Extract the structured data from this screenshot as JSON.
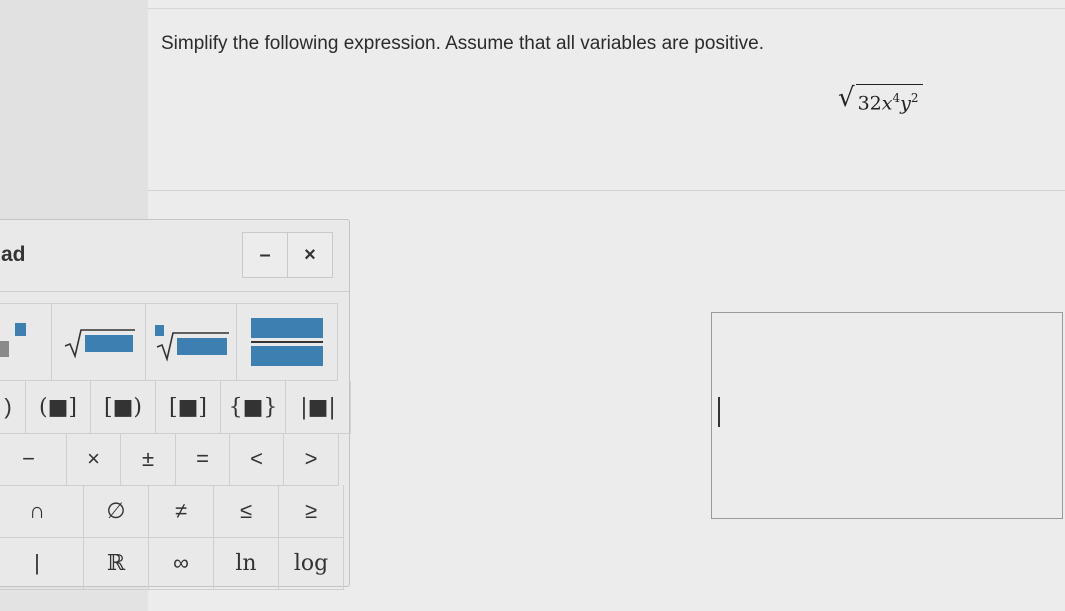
{
  "question": {
    "text": "Simplify the following expression. Assume that all variables are positive.",
    "expression": {
      "coefficient": "32",
      "var1": "x",
      "exp1": "4",
      "var2": "y",
      "exp2": "2"
    }
  },
  "keypad": {
    "title": "ad",
    "minimize_label": "–",
    "close_label": "×",
    "bracket_keys": [
      "(■]",
      "[■)",
      "[■]",
      "{■}",
      "|■|"
    ],
    "operator_keys": [
      "−",
      "×",
      "±",
      "=",
      "<",
      ">"
    ],
    "relation_keys": [
      "∩",
      "∅",
      "≠",
      "≤",
      "≥"
    ],
    "misc_keys": [
      "|",
      "ℝ",
      "∞",
      "ln",
      "log"
    ]
  },
  "colors": {
    "accent": "#3c7fb0"
  }
}
